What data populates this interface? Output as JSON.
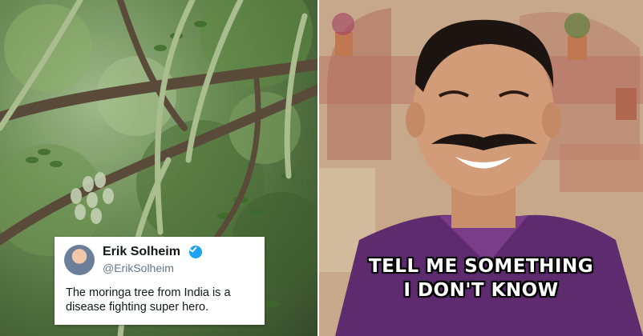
{
  "tweet": {
    "display_name": "Erik Solheim",
    "handle": "@ErikSolheim",
    "text": "The moringa tree from India is a disease fighting super hero.",
    "verified_color": "#1da1f2"
  },
  "caption": {
    "line1": "TELL ME SOMETHING",
    "line2": "I DON'T KNOW"
  },
  "icons": {
    "verified": "verified-badge-icon",
    "avatar": "profile-photo"
  }
}
